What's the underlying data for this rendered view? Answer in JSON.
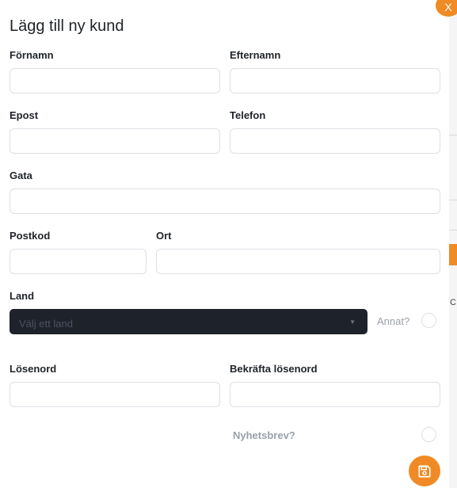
{
  "modal": {
    "title": "Lägg till ny kund",
    "close_label": "X"
  },
  "form": {
    "first_name": {
      "label": "Förnamn",
      "value": "",
      "placeholder": ""
    },
    "last_name": {
      "label": "Efternamn",
      "value": "",
      "placeholder": ""
    },
    "email": {
      "label": "Epost",
      "value": "",
      "placeholder": ""
    },
    "phone": {
      "label": "Telefon",
      "value": "",
      "placeholder": ""
    },
    "street": {
      "label": "Gata",
      "value": "",
      "placeholder": ""
    },
    "postcode": {
      "label": "Postkod",
      "value": "",
      "placeholder": ""
    },
    "city": {
      "label": "Ort",
      "value": "",
      "placeholder": ""
    },
    "country": {
      "label": "Land",
      "selected": "Välj ett land"
    },
    "other": {
      "label": "Annat?",
      "checked": false
    },
    "password": {
      "label": "Lösenord",
      "value": "",
      "placeholder": ""
    },
    "confirm_password": {
      "label": "Bekräfta lösenord",
      "value": "",
      "placeholder": ""
    },
    "newsletter": {
      "label": "Nyhetsbrev?",
      "checked": false
    }
  },
  "icons": {
    "close": "close-icon",
    "save": "save-icon",
    "caret": "chevron-down-icon"
  },
  "colors": {
    "accent": "#f08a24",
    "select_bg": "#1e232b",
    "input_border": "#dcdfe4",
    "muted_text": "#9aa0a8"
  }
}
